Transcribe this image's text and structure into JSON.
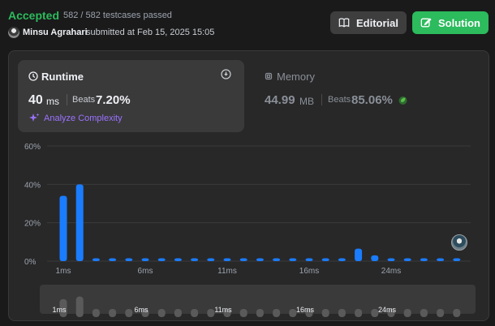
{
  "header": {
    "status": "Accepted",
    "testcases": "582 / 582 testcases passed",
    "user_name": "Minsu Agrahari",
    "submitted": "submitted at Feb 15, 2025 15:05",
    "editorial_label": "Editorial",
    "solution_label": "Solution"
  },
  "runtime": {
    "label": "Runtime",
    "value": "40",
    "unit": "ms",
    "beats_label": "Beats",
    "beats": "7.20%",
    "analyze_label": "Analyze Complexity"
  },
  "memory": {
    "label": "Memory",
    "value": "44.99",
    "unit": "MB",
    "beats_label": "Beats",
    "beats": "85.06%"
  },
  "icons": {
    "runtime": "clock-icon",
    "info": "info-icon",
    "memory": "chip-icon",
    "analyze": "sparkle-icon",
    "editorial": "book-icon",
    "solution": "edit-icon",
    "memory_badge": "leaf-badge-icon"
  },
  "colors": {
    "accepted": "#2cbb5d",
    "bar": "#1a7cff",
    "analyze": "#9b72ff",
    "solution_button": "#2cbb5d"
  },
  "chart_data": {
    "type": "bar",
    "ylim": [
      0,
      60
    ],
    "yticks": [
      "60%",
      "40%",
      "20%",
      "0%"
    ],
    "ytick_values": [
      60,
      40,
      20,
      0
    ],
    "xtick_labels": [
      "1ms",
      "6ms",
      "11ms",
      "16ms",
      "24ms"
    ],
    "xtick_index": [
      0,
      5,
      10,
      15,
      20
    ],
    "values": [
      34,
      40,
      1.5,
      1.5,
      1.5,
      1.5,
      1.5,
      1.5,
      1.5,
      1.5,
      1.5,
      1.5,
      1.5,
      1.5,
      1.5,
      1.5,
      1.5,
      1.5,
      6.5,
      3,
      1.5,
      1.5,
      1.5,
      1.5,
      1.5
    ],
    "highlight_index": 24,
    "grid": true,
    "overview": {
      "xtick_labels": [
        "1ms",
        "6ms",
        "11ms",
        "16ms",
        "24ms"
      ]
    }
  }
}
